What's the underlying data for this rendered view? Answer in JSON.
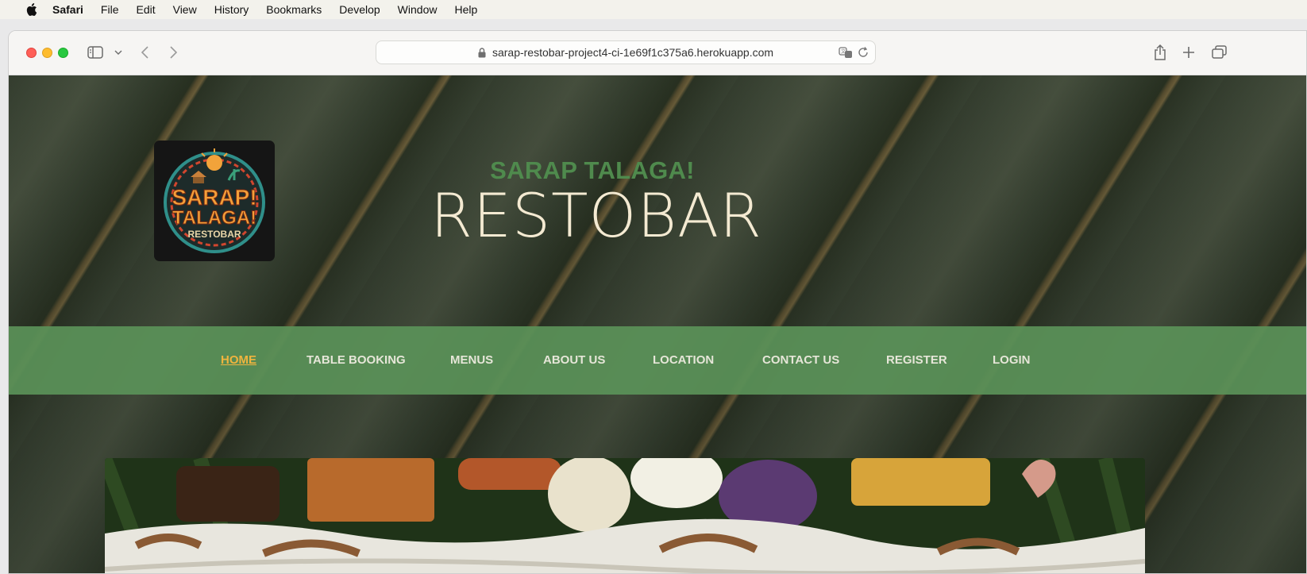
{
  "menubar": {
    "app": "Safari",
    "items": [
      "File",
      "Edit",
      "View",
      "History",
      "Bookmarks",
      "Develop",
      "Window",
      "Help"
    ]
  },
  "browser": {
    "url": "sarap-restobar-project4-ci-1e69f1c375a6.herokuapp.com",
    "icons": [
      "sidebar-icon",
      "chevron-down-icon",
      "back-icon",
      "forward-icon",
      "lock-icon",
      "translate-icon",
      "reload-icon",
      "share-icon",
      "new-tab-icon",
      "tab-overview-icon"
    ]
  },
  "site": {
    "logo": {
      "line1": "SARAP!",
      "line2": "TALAGA!",
      "line3": "RESTOBAR"
    },
    "tagline": "SARAP TALAGA!",
    "brand": "RESTOBAR",
    "nav": [
      {
        "label": "HOME",
        "active": true
      },
      {
        "label": "TABLE BOOKING",
        "active": false
      },
      {
        "label": "MENUS",
        "active": false
      },
      {
        "label": "ABOUT US",
        "active": false
      },
      {
        "label": "LOCATION",
        "active": false
      },
      {
        "label": "CONTACT US",
        "active": false
      },
      {
        "label": "REGISTER",
        "active": false
      },
      {
        "label": "LOGIN",
        "active": false
      }
    ]
  },
  "colors": {
    "nav_bg": "#5a9158",
    "nav_active": "#f0b43e",
    "tagline": "#4f8a4d",
    "brand": "#f4ead2"
  }
}
